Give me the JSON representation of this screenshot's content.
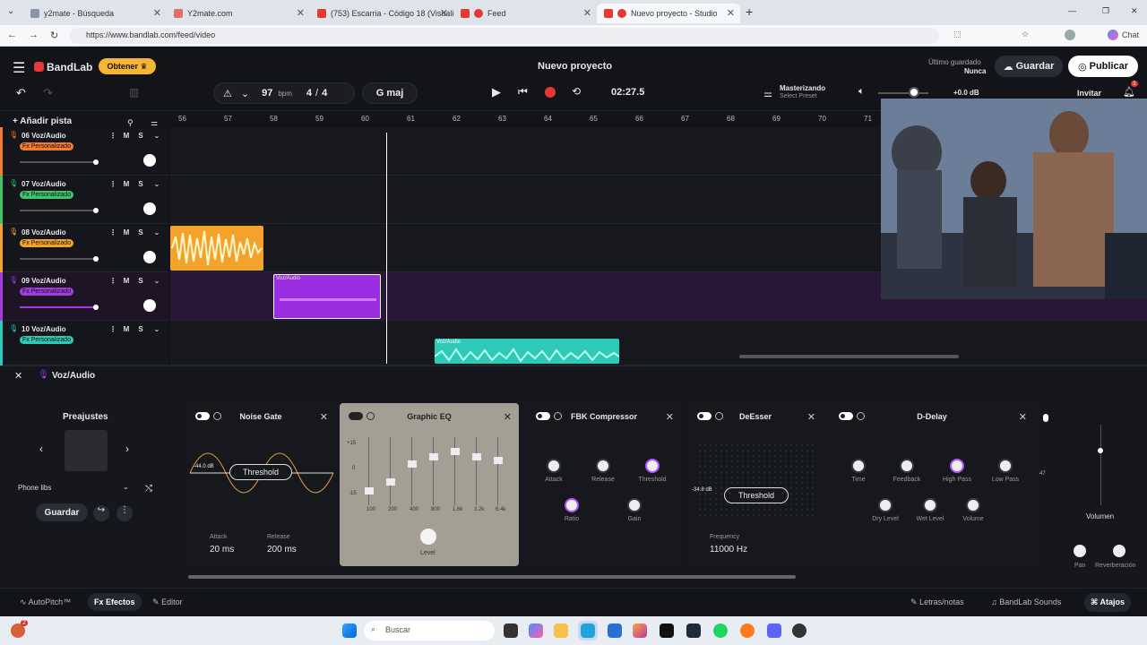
{
  "browser": {
    "tabs": [
      {
        "label": "y2mate - Búsqueda",
        "color": "#8b95a7"
      },
      {
        "label": "Y2mate.com",
        "color": "#e26d6d"
      },
      {
        "label": "(753) Escarria - Código 18 (Visuali...",
        "color": "#e53935"
      },
      {
        "label": "Feed",
        "color": "#e53935"
      },
      {
        "label": "Nuevo proyecto - Studio",
        "color": "#e53935"
      }
    ],
    "url": "https://www.bandlab.com/feed/video",
    "chat": "Chat"
  },
  "app": {
    "brand": "BandLab",
    "obtener": "Obtener",
    "project_title": "Nuevo proyecto",
    "last_saved_label": "Último guardado",
    "last_saved_value": "Nunca",
    "save": "Guardar",
    "publish": "Publicar",
    "bpm": "97",
    "bpm_unit": "bpm",
    "time_sig_num": "4",
    "time_sig_sep": "/",
    "time_sig_den": "4",
    "key": "G maj",
    "time": "02:27.5",
    "mastering": "Masterizando",
    "select_preset": "Select Preset",
    "volume_db": "+0.0 dB",
    "invite": "Invitar",
    "notif_count": "1",
    "add_track": "Añadir pista"
  },
  "ruler": [
    "56",
    "57",
    "58",
    "59",
    "60",
    "61",
    "62",
    "63",
    "64",
    "65",
    "66",
    "67",
    "68",
    "69",
    "70",
    "71"
  ],
  "tracks": [
    {
      "name": "06 Voz/Audio",
      "fx": "Fx Personalizado",
      "fx_color": "#f47a30"
    },
    {
      "name": "07 Voz/Audio",
      "fx": "Fx Personalizado",
      "fx_color": "#3ec46d"
    },
    {
      "name": "08 Voz/Audio",
      "fx": "Fx Personalizado",
      "fx_color": "#f3a32b"
    },
    {
      "name": "09 Voz/Audio",
      "fx": "Fx Personalizado",
      "fx_color": "#a23de0"
    },
    {
      "name": "10 Voz/Audio",
      "fx": "Fx Personalizado",
      "fx_color": "#2fc9b8"
    }
  ],
  "clips": {
    "clip9": "Voz/Audio",
    "clip10": "Voz/Audio"
  },
  "fx": {
    "track_label": "Voz/Audio",
    "presets_title": "Preajustes",
    "preset_name": "Phone libs",
    "save": "Guardar",
    "noise_gate": {
      "title": "Noise Gate",
      "db": "-44.0 dB",
      "threshold": "Threshold",
      "attack_label": "Attack",
      "attack": "20 ms",
      "release_label": "Release",
      "release": "200 ms"
    },
    "eq": {
      "title": "Graphic EQ",
      "scale": [
        "+15",
        "0",
        "-15"
      ],
      "bands": [
        "100",
        "200",
        "400",
        "800",
        "1.6k",
        "3.2k",
        "6.4k"
      ],
      "level": "Level"
    },
    "comp": {
      "title": "FBK Compressor",
      "knobs": [
        "Attack",
        "Release",
        "Threshold",
        "Ratio",
        "Gain"
      ]
    },
    "deesser": {
      "title": "DeEsser",
      "db": "-34.8 dB",
      "threshold": "Threshold",
      "freq_label": "Frequency",
      "freq": "11000 Hz"
    },
    "delay": {
      "title": "D-Delay",
      "knobs": [
        "Time",
        "Feedback",
        "High Pass",
        "Low Pass",
        "Dry Level",
        "Wet Level",
        "Volume"
      ]
    },
    "side_value": "47",
    "volume": "Volumen",
    "pan": "Pan",
    "reverb": "Reverberación"
  },
  "bottom": {
    "autopitch": "AutoPitch™",
    "effects": "Efectos",
    "editor": "Editor",
    "lyrics": "Letras/notas",
    "sounds": "BandLab Sounds",
    "shortcuts": "Atajos"
  },
  "taskbar": {
    "search": "Buscar",
    "badge": "2"
  }
}
